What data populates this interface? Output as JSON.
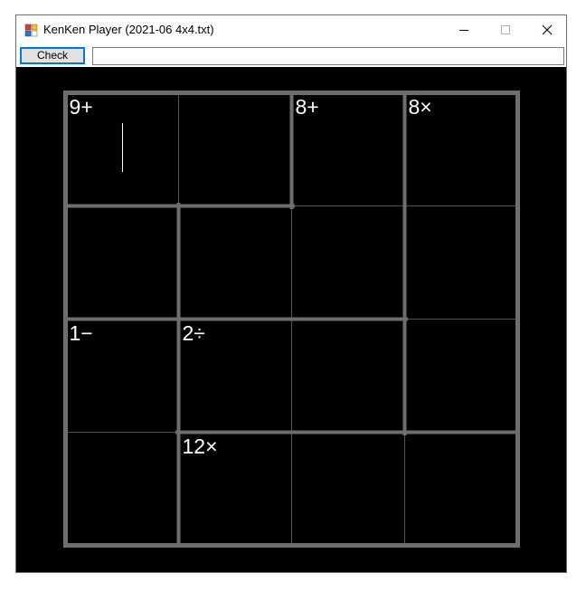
{
  "window": {
    "title": "KenKen Player (2021-06 4x4.txt)",
    "icon": "app-icon",
    "controls": [
      "minimize-icon",
      "maximize-icon",
      "close-icon"
    ]
  },
  "toolbar": {
    "check_label": "Check",
    "status_value": ""
  },
  "puzzle": {
    "size": 4,
    "cells": [
      [
        "",
        "",
        "",
        ""
      ],
      [
        "",
        "",
        "",
        ""
      ],
      [
        "",
        "",
        "",
        ""
      ],
      [
        "",
        "",
        "",
        ""
      ]
    ],
    "cages": [
      {
        "clue": "9+",
        "cells": [
          [
            0,
            0
          ],
          [
            0,
            1
          ]
        ]
      },
      {
        "clue": "8+",
        "cells": [
          [
            0,
            2
          ],
          [
            1,
            2
          ],
          [
            1,
            1
          ]
        ]
      },
      {
        "clue": "8×",
        "cells": [
          [
            0,
            3
          ],
          [
            1,
            0
          ],
          [
            1,
            3
          ],
          [
            2,
            3
          ]
        ]
      },
      {
        "clue": "1−",
        "cells": [
          [
            2,
            0
          ],
          [
            3,
            0
          ]
        ]
      },
      {
        "clue": "2÷",
        "cells": [
          [
            2,
            1
          ],
          [
            2,
            2
          ]
        ]
      },
      {
        "clue": "12×",
        "cells": [
          [
            3,
            1
          ],
          [
            3,
            2
          ],
          [
            3,
            3
          ]
        ]
      }
    ],
    "cursor_cell": [
      0,
      0
    ]
  },
  "colors": {
    "background": "#000000",
    "cell_text": "#ffffff",
    "cage_border": "#6e6e6e",
    "thin_line": "#555555",
    "button_focus": "#0078d7"
  }
}
